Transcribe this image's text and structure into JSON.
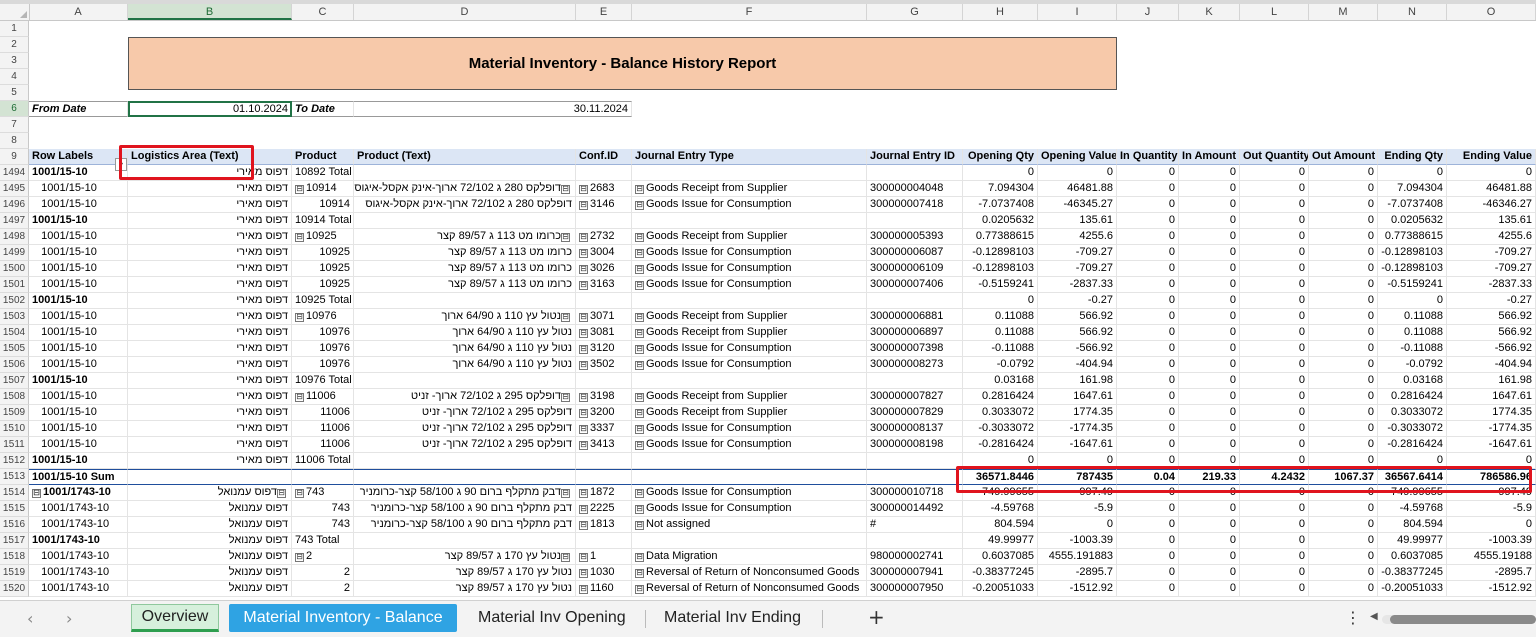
{
  "columns": [
    "A",
    "B",
    "C",
    "D",
    "E",
    "F",
    "G",
    "H",
    "I",
    "J",
    "K",
    "L",
    "M",
    "N",
    "O"
  ],
  "report": {
    "title": "Material Inventory - Balance History Report",
    "from_label": "From Date",
    "from_value": "01.10.2024",
    "to_label": "To Date",
    "to_value": "30.11.2024"
  },
  "headers": [
    "Row Labels",
    "Logistics Area (Text)",
    "Product",
    "Product (Text)",
    "Conf.ID",
    "Journal Entry Type",
    "Journal Entry ID",
    "Opening Qty",
    "Opening Value",
    "In Quantity",
    "In Amount",
    "Out Quantity",
    "Out Amount",
    "Ending Qty",
    "Ending Value"
  ],
  "rows": [
    {
      "n": "1494",
      "t": "tot",
      "a": "1001/15-10",
      "b": "דפוס מאירי",
      "c": "10892 Total",
      "d": "",
      "e": "",
      "f": "",
      "g": "",
      "v": [
        "0",
        "0",
        "0",
        "0",
        "0",
        "0",
        "0",
        "0"
      ]
    },
    {
      "n": "1495",
      "a": "1001/15-10",
      "b": "דפוס מאירי",
      "cx": "⊟",
      "c": "10914",
      "dx": "⊟",
      "d": "דופלקס 280 ג 72/102 ארוך-אינק אקסל-איגוס",
      "ex": "⊟",
      "e": "2683",
      "fx": "⊟",
      "f": "Goods Receipt from Supplier",
      "g": "300000004048",
      "v": [
        "7.094304",
        "46481.88",
        "0",
        "0",
        "0",
        "0",
        "7.094304",
        "46481.88"
      ]
    },
    {
      "n": "1496",
      "a": "1001/15-10",
      "b": "דפוס מאירי",
      "c": "10914",
      "d": "דופלקס 280 ג 72/102 ארוך-אינק אקסל-איגוס",
      "ex": "⊟",
      "e": "3146",
      "fx": "⊟",
      "f": "Goods Issue for Consumption",
      "g": "300000007418",
      "v": [
        "-7.0737408",
        "-46345.27",
        "0",
        "0",
        "0",
        "0",
        "-7.0737408",
        "-46346.27"
      ]
    },
    {
      "n": "1497",
      "t": "tot",
      "a": "1001/15-10",
      "b": "דפוס מאירי",
      "c": "10914 Total",
      "d": "",
      "e": "",
      "f": "",
      "g": "",
      "v": [
        "0.0205632",
        "135.61",
        "0",
        "0",
        "0",
        "0",
        "0.0205632",
        "135.61"
      ]
    },
    {
      "n": "1498",
      "a": "1001/15-10",
      "b": "דפוס מאירי",
      "cx": "⊟",
      "c": "10925",
      "dx": "⊟",
      "d": "כרומו מט 113 ג 89/57 קצר",
      "ex": "⊟",
      "e": "2732",
      "fx": "⊟",
      "f": "Goods Receipt from Supplier",
      "g": "300000005393",
      "v": [
        "0.77388615",
        "4255.6",
        "0",
        "0",
        "0",
        "0",
        "0.77388615",
        "4255.6"
      ]
    },
    {
      "n": "1499",
      "a": "1001/15-10",
      "b": "דפוס מאירי",
      "c": "10925",
      "d": "כרומו מט 113 ג 89/57 קצר",
      "ex": "⊟",
      "e": "3004",
      "fx": "⊟",
      "f": "Goods Issue for Consumption",
      "g": "300000006087",
      "v": [
        "-0.12898103",
        "-709.27",
        "0",
        "0",
        "0",
        "0",
        "-0.12898103",
        "-709.27"
      ]
    },
    {
      "n": "1500",
      "a": "1001/15-10",
      "b": "דפוס מאירי",
      "c": "10925",
      "d": "כרומו מט 113 ג 89/57 קצר",
      "ex": "⊟",
      "e": "3026",
      "fx": "⊟",
      "f": "Goods Issue for Consumption",
      "g": "300000006109",
      "v": [
        "-0.12898103",
        "-709.27",
        "0",
        "0",
        "0",
        "0",
        "-0.12898103",
        "-709.27"
      ]
    },
    {
      "n": "1501",
      "a": "1001/15-10",
      "b": "דפוס מאירי",
      "c": "10925",
      "d": "כרומו מט 113 ג 89/57 קצר",
      "ex": "⊟",
      "e": "3163",
      "fx": "⊟",
      "f": "Goods Issue for Consumption",
      "g": "300000007406",
      "v": [
        "-0.5159241",
        "-2837.33",
        "0",
        "0",
        "0",
        "0",
        "-0.5159241",
        "-2837.33"
      ]
    },
    {
      "n": "1502",
      "t": "tot",
      "a": "1001/15-10",
      "b": "דפוס מאירי",
      "c": "10925 Total",
      "d": "",
      "e": "",
      "f": "",
      "g": "",
      "v": [
        "0",
        "-0.27",
        "0",
        "0",
        "0",
        "0",
        "0",
        "-0.27"
      ]
    },
    {
      "n": "1503",
      "a": "1001/15-10",
      "b": "דפוס מאירי",
      "cx": "⊟",
      "c": "10976",
      "dx": "⊟",
      "d": "נטול עץ 110 ג 64/90 ארוך",
      "ex": "⊟",
      "e": "3071",
      "fx": "⊟",
      "f": "Goods Receipt from Supplier",
      "g": "300000006881",
      "v": [
        "0.11088",
        "566.92",
        "0",
        "0",
        "0",
        "0",
        "0.11088",
        "566.92"
      ]
    },
    {
      "n": "1504",
      "a": "1001/15-10",
      "b": "דפוס מאירי",
      "c": "10976",
      "d": "נטול עץ 110 ג 64/90 ארוך",
      "ex": "⊟",
      "e": "3081",
      "fx": "⊟",
      "f": "Goods Receipt from Supplier",
      "g": "300000006897",
      "v": [
        "0.11088",
        "566.92",
        "0",
        "0",
        "0",
        "0",
        "0.11088",
        "566.92"
      ]
    },
    {
      "n": "1505",
      "a": "1001/15-10",
      "b": "דפוס מאירי",
      "c": "10976",
      "d": "נטול עץ 110 ג 64/90 ארוך",
      "ex": "⊟",
      "e": "3120",
      "fx": "⊟",
      "f": "Goods Issue for Consumption",
      "g": "300000007398",
      "v": [
        "-0.11088",
        "-566.92",
        "0",
        "0",
        "0",
        "0",
        "-0.11088",
        "-566.92"
      ]
    },
    {
      "n": "1506",
      "a": "1001/15-10",
      "b": "דפוס מאירי",
      "c": "10976",
      "d": "נטול עץ 110 ג 64/90 ארוך",
      "ex": "⊟",
      "e": "3502",
      "fx": "⊟",
      "f": "Goods Issue for Consumption",
      "g": "300000008273",
      "v": [
        "-0.0792",
        "-404.94",
        "0",
        "0",
        "0",
        "0",
        "-0.0792",
        "-404.94"
      ]
    },
    {
      "n": "1507",
      "t": "tot",
      "a": "1001/15-10",
      "b": "דפוס מאירי",
      "c": "10976 Total",
      "d": "",
      "e": "",
      "f": "",
      "g": "",
      "v": [
        "0.03168",
        "161.98",
        "0",
        "0",
        "0",
        "0",
        "0.03168",
        "161.98"
      ]
    },
    {
      "n": "1508",
      "a": "1001/15-10",
      "b": "דפוס מאירי",
      "cx": "⊟",
      "c": "11006",
      "dx": "⊟",
      "d": "דופלקס 295 ג 72/102 ארוך- זניט",
      "ex": "⊟",
      "e": "3198",
      "fx": "⊟",
      "f": "Goods Receipt from Supplier",
      "g": "300000007827",
      "v": [
        "0.2816424",
        "1647.61",
        "0",
        "0",
        "0",
        "0",
        "0.2816424",
        "1647.61"
      ]
    },
    {
      "n": "1509",
      "a": "1001/15-10",
      "b": "דפוס מאירי",
      "c": "11006",
      "d": "דופלקס 295 ג 72/102 ארוך- זניט",
      "ex": "⊟",
      "e": "3200",
      "fx": "⊟",
      "f": "Goods Receipt from Supplier",
      "g": "300000007829",
      "v": [
        "0.3033072",
        "1774.35",
        "0",
        "0",
        "0",
        "0",
        "0.3033072",
        "1774.35"
      ]
    },
    {
      "n": "1510",
      "a": "1001/15-10",
      "b": "דפוס מאירי",
      "c": "11006",
      "d": "דופלקס 295 ג 72/102 ארוך- זניט",
      "ex": "⊟",
      "e": "3337",
      "fx": "⊟",
      "f": "Goods Issue for Consumption",
      "g": "300000008137",
      "v": [
        "-0.3033072",
        "-1774.35",
        "0",
        "0",
        "0",
        "0",
        "-0.3033072",
        "-1774.35"
      ]
    },
    {
      "n": "1511",
      "a": "1001/15-10",
      "b": "דפוס מאירי",
      "c": "11006",
      "d": "דופלקס 295 ג 72/102 ארוך- זניט",
      "ex": "⊟",
      "e": "3413",
      "fx": "⊟",
      "f": "Goods Issue for Consumption",
      "g": "300000008198",
      "v": [
        "-0.2816424",
        "-1647.61",
        "0",
        "0",
        "0",
        "0",
        "-0.2816424",
        "-1647.61"
      ]
    },
    {
      "n": "1512",
      "t": "tot",
      "a": "1001/15-10",
      "b": "דפוס מאירי",
      "c": "11006 Total",
      "d": "",
      "e": "",
      "f": "",
      "g": "",
      "v": [
        "0",
        "0",
        "0",
        "0",
        "0",
        "0",
        "0",
        "0"
      ]
    },
    {
      "n": "1513",
      "t": "sum",
      "a": "1001/15-10 Sum",
      "b": "",
      "c": "",
      "d": "",
      "e": "",
      "f": "",
      "g": "",
      "v": [
        "36571.8446",
        "787435",
        "0.04",
        "219.33",
        "4.2432",
        "1067.37",
        "36567.6414",
        "786586.96"
      ]
    },
    {
      "n": "1514",
      "t": "grp",
      "ax": "⊟",
      "a": "1001/1743-10",
      "bx": "⊟",
      "b": "דפוס עמנואל",
      "cx": "⊟",
      "c": "743",
      "dx": "⊟",
      "d": "דבק מתקלף ברום 90 ג 58/100 קצר-כרומניר",
      "ex": "⊟",
      "e": "1872",
      "fx": "⊟",
      "f": "Goods Issue for Consumption",
      "g": "300000010718",
      "v": [
        "-749.99655",
        "-997.49",
        "0",
        "0",
        "0",
        "0",
        "-749.99655",
        "-997.49"
      ]
    },
    {
      "n": "1515",
      "a": "1001/1743-10",
      "b": "דפוס עמנואל",
      "c": "743",
      "d": "דבק מתקלף ברום 90 ג 58/100 קצר-כרומניר",
      "ex": "⊟",
      "e": "2225",
      "fx": "⊟",
      "f": "Goods Issue for Consumption",
      "g": "300000014492",
      "v": [
        "-4.59768",
        "-5.9",
        "0",
        "0",
        "0",
        "0",
        "-4.59768",
        "-5.9"
      ]
    },
    {
      "n": "1516",
      "a": "1001/1743-10",
      "b": "דפוס עמנואל",
      "c": "743",
      "d": "דבק מתקלף ברום 90 ג 58/100 קצר-כרומניר",
      "ex": "⊟",
      "e": "1813",
      "fx": "⊟",
      "f": "Not assigned",
      "g": "#",
      "v": [
        "804.594",
        "0",
        "0",
        "0",
        "0",
        "0",
        "804.594",
        "0"
      ]
    },
    {
      "n": "1517",
      "t": "tot",
      "a": "1001/1743-10",
      "b": "דפוס עמנואל",
      "c": "743 Total",
      "d": "",
      "e": "",
      "f": "",
      "g": "",
      "v": [
        "49.99977",
        "-1003.39",
        "0",
        "0",
        "0",
        "0",
        "49.99977",
        "-1003.39"
      ]
    },
    {
      "n": "1518",
      "a": "1001/1743-10",
      "b": "דפוס עמנואל",
      "cx": "⊟",
      "c": "2",
      "dx": "⊟",
      "d": "נטול עץ 170 ג 89/57 קצר",
      "ex": "⊟",
      "e": "1",
      "fx": "⊟",
      "f": "Data Migration",
      "g": "980000002741",
      "v": [
        "0.6037085",
        "4555.191883",
        "0",
        "0",
        "0",
        "0",
        "0.6037085",
        "4555.19188"
      ]
    },
    {
      "n": "1519",
      "a": "1001/1743-10",
      "b": "דפוס עמנואל",
      "c": "2",
      "d": "נטול עץ 170 ג 89/57 קצר",
      "ex": "⊟",
      "e": "1030",
      "fx": "⊟",
      "f": "Reversal of Return of Nonconsumed Goods",
      "g": "300000007941",
      "v": [
        "-0.38377245",
        "-2895.7",
        "0",
        "0",
        "0",
        "0",
        "-0.38377245",
        "-2895.7"
      ]
    },
    {
      "n": "1520",
      "a": "1001/1743-10",
      "b": "דפוס עמנואל",
      "c": "2",
      "d": "נטול עץ 170 ג 89/57 קצר",
      "ex": "⊟",
      "e": "1160",
      "fx": "⊟",
      "f": "Reversal of Return of Nonconsumed Goods",
      "g": "300000007950",
      "v": [
        "-0.20051033",
        "-1512.92",
        "0",
        "0",
        "0",
        "0",
        "-0.20051033",
        "-1512.92"
      ]
    }
  ],
  "tabs": {
    "overview": "Overview",
    "balance": "Material Inventory - Balance",
    "opening": "Material Inv Opening",
    "ending": "Material Inv Ending",
    "add": "+",
    "more": "⋮",
    "prev": "‹",
    "next": "›"
  }
}
